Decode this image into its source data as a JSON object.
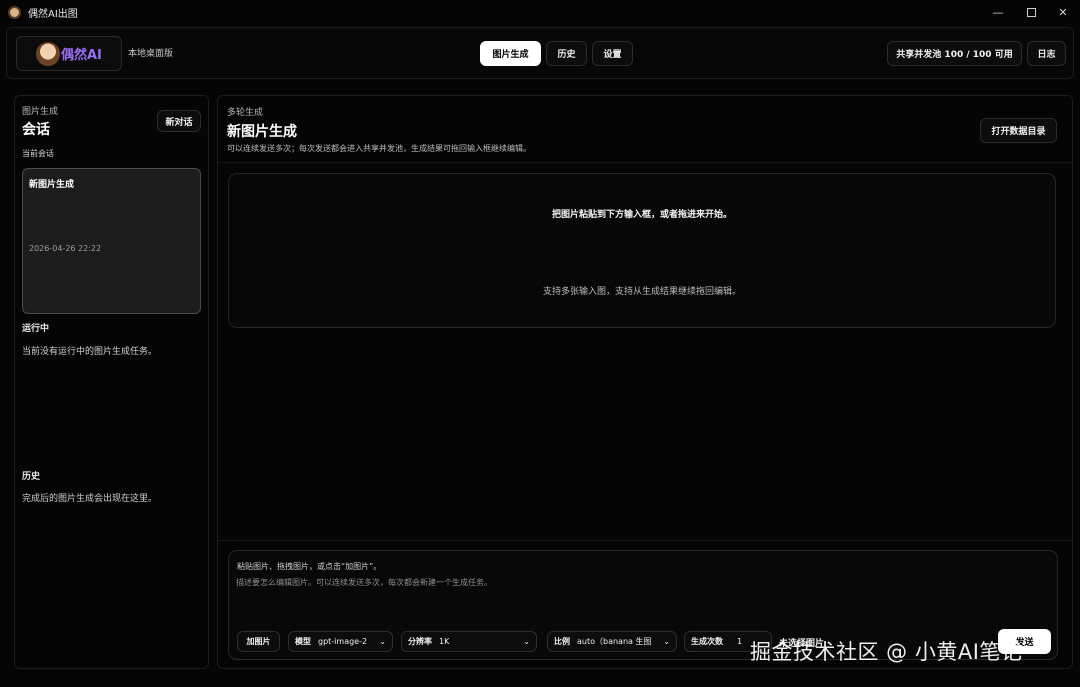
{
  "window": {
    "title": "偶然AI出图",
    "icons": {
      "app": "app-avatar-icon",
      "minimize": "minimize-icon",
      "maximize": "maximize-icon",
      "close": "close-icon"
    }
  },
  "header": {
    "brand": "偶然AI",
    "brand_color": "#9a6cf5",
    "subtitle": "本地桌面版",
    "tabs": [
      {
        "label": "图片生成",
        "active": true
      },
      {
        "label": "历史",
        "active": false
      },
      {
        "label": "设置",
        "active": false
      }
    ],
    "pool_status": "共享并发池 100 / 100 可用",
    "log_button": "日志"
  },
  "sidebar": {
    "kicker": "图片生成",
    "title": "会话",
    "new_chat": "新对话",
    "current_label": "当前会话",
    "sessions": [
      {
        "name": "新图片生成",
        "time": "2026-04-26 22:22"
      }
    ],
    "running_label": "运行中",
    "running_empty": "当前没有运行中的图片生成任务。",
    "history_label": "历史",
    "history_empty": "完成后的图片生成会出现在这里。"
  },
  "main": {
    "kicker": "多轮生成",
    "title": "新图片生成",
    "description": "可以连续发送多次；每次发送都会进入共享并发池，生成结果可拖回输入框继续编辑。",
    "open_dir": "打开数据目录",
    "dropzone": {
      "primary": "把图片粘贴到下方输入框，或者拖进来开始。",
      "secondary": "支持多张输入图，支持从生成结果继续拖回编辑。"
    }
  },
  "composer": {
    "hint": "粘贴图片、拖拽图片，或点击“加图片”。",
    "placeholder": "描述要怎么编辑图片。可以连续发送多次，每次都会新建一个生成任务。",
    "add_image": "加图片",
    "model": {
      "label": "模型",
      "value": "gpt-image-2"
    },
    "resolution": {
      "label": "分辨率",
      "value": "1K"
    },
    "ratio": {
      "label": "比例",
      "value": "auto（banana 生图"
    },
    "count": {
      "label": "生成次数",
      "value": "1"
    },
    "no_image": "未选择图片",
    "send": "发送"
  },
  "watermark": "掘金技术社区 @ 小黄AI笔记"
}
